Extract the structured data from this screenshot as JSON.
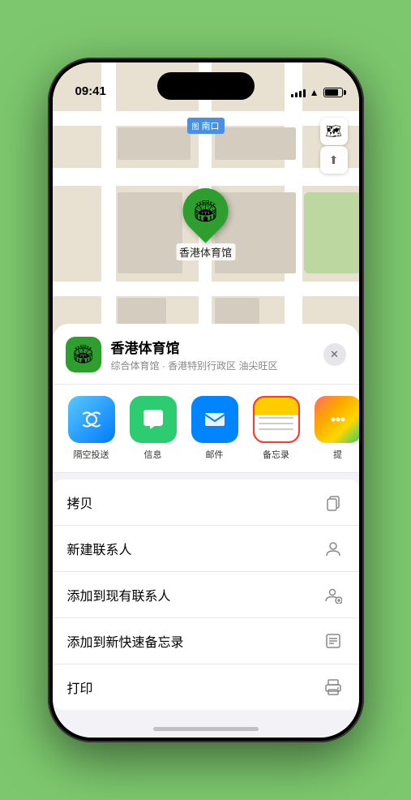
{
  "status_bar": {
    "time": "09:41",
    "time_icon": "▶",
    "signal": "●●●●",
    "wifi": "WiFi",
    "battery": "Battery"
  },
  "map": {
    "label_icon": "图",
    "label_text": "南口",
    "venue_name": "香港体育馆",
    "pin_emoji": "🏟"
  },
  "map_controls": {
    "map_btn_icon": "🗺",
    "location_btn_icon": "⬆"
  },
  "sheet": {
    "close_btn": "✕",
    "venue_name": "香港体育馆",
    "venue_desc": "综合体育馆 · 香港特别行政区 油尖旺区",
    "venue_logo_emoji": "🏟"
  },
  "share_items": [
    {
      "label": "隔空投送",
      "type": "airdrop"
    },
    {
      "label": "信息",
      "type": "messages"
    },
    {
      "label": "邮件",
      "type": "mail"
    },
    {
      "label": "备忘录",
      "type": "notes",
      "selected": true
    },
    {
      "label": "提",
      "type": "more"
    }
  ],
  "actions": [
    {
      "label": "拷贝",
      "icon": "📋"
    },
    {
      "label": "新建联系人",
      "icon": "👤"
    },
    {
      "label": "添加到现有联系人",
      "icon": "👤+"
    },
    {
      "label": "添加到新快速备忘录",
      "icon": "📝"
    },
    {
      "label": "打印",
      "icon": "🖨"
    }
  ]
}
